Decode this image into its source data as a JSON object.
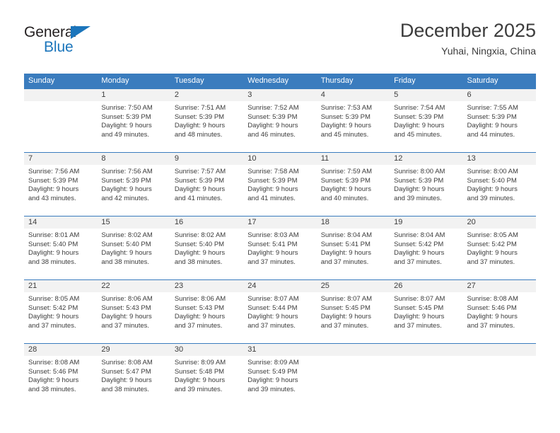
{
  "logo": {
    "word_top": "General",
    "word_bottom": "Blue",
    "triangle_color": "#1b75bb",
    "text_color": "#231f20"
  },
  "header": {
    "title": "December 2025",
    "subtitle": "Yuhai, Ningxia, China"
  },
  "theme": {
    "header_blue": "#3a7cbe",
    "daynum_band": "#f2f2f2",
    "text": "#3c3c3c"
  },
  "weekdays": [
    "Sunday",
    "Monday",
    "Tuesday",
    "Wednesday",
    "Thursday",
    "Friday",
    "Saturday"
  ],
  "weeks": [
    [
      {
        "day": "",
        "sunrise": "",
        "sunset": "",
        "daylight_1": "",
        "daylight_2": ""
      },
      {
        "day": "1",
        "sunrise": "Sunrise: 7:50 AM",
        "sunset": "Sunset: 5:39 PM",
        "daylight_1": "Daylight: 9 hours",
        "daylight_2": "and 49 minutes."
      },
      {
        "day": "2",
        "sunrise": "Sunrise: 7:51 AM",
        "sunset": "Sunset: 5:39 PM",
        "daylight_1": "Daylight: 9 hours",
        "daylight_2": "and 48 minutes."
      },
      {
        "day": "3",
        "sunrise": "Sunrise: 7:52 AM",
        "sunset": "Sunset: 5:39 PM",
        "daylight_1": "Daylight: 9 hours",
        "daylight_2": "and 46 minutes."
      },
      {
        "day": "4",
        "sunrise": "Sunrise: 7:53 AM",
        "sunset": "Sunset: 5:39 PM",
        "daylight_1": "Daylight: 9 hours",
        "daylight_2": "and 45 minutes."
      },
      {
        "day": "5",
        "sunrise": "Sunrise: 7:54 AM",
        "sunset": "Sunset: 5:39 PM",
        "daylight_1": "Daylight: 9 hours",
        "daylight_2": "and 45 minutes."
      },
      {
        "day": "6",
        "sunrise": "Sunrise: 7:55 AM",
        "sunset": "Sunset: 5:39 PM",
        "daylight_1": "Daylight: 9 hours",
        "daylight_2": "and 44 minutes."
      }
    ],
    [
      {
        "day": "7",
        "sunrise": "Sunrise: 7:56 AM",
        "sunset": "Sunset: 5:39 PM",
        "daylight_1": "Daylight: 9 hours",
        "daylight_2": "and 43 minutes."
      },
      {
        "day": "8",
        "sunrise": "Sunrise: 7:56 AM",
        "sunset": "Sunset: 5:39 PM",
        "daylight_1": "Daylight: 9 hours",
        "daylight_2": "and 42 minutes."
      },
      {
        "day": "9",
        "sunrise": "Sunrise: 7:57 AM",
        "sunset": "Sunset: 5:39 PM",
        "daylight_1": "Daylight: 9 hours",
        "daylight_2": "and 41 minutes."
      },
      {
        "day": "10",
        "sunrise": "Sunrise: 7:58 AM",
        "sunset": "Sunset: 5:39 PM",
        "daylight_1": "Daylight: 9 hours",
        "daylight_2": "and 41 minutes."
      },
      {
        "day": "11",
        "sunrise": "Sunrise: 7:59 AM",
        "sunset": "Sunset: 5:39 PM",
        "daylight_1": "Daylight: 9 hours",
        "daylight_2": "and 40 minutes."
      },
      {
        "day": "12",
        "sunrise": "Sunrise: 8:00 AM",
        "sunset": "Sunset: 5:39 PM",
        "daylight_1": "Daylight: 9 hours",
        "daylight_2": "and 39 minutes."
      },
      {
        "day": "13",
        "sunrise": "Sunrise: 8:00 AM",
        "sunset": "Sunset: 5:40 PM",
        "daylight_1": "Daylight: 9 hours",
        "daylight_2": "and 39 minutes."
      }
    ],
    [
      {
        "day": "14",
        "sunrise": "Sunrise: 8:01 AM",
        "sunset": "Sunset: 5:40 PM",
        "daylight_1": "Daylight: 9 hours",
        "daylight_2": "and 38 minutes."
      },
      {
        "day": "15",
        "sunrise": "Sunrise: 8:02 AM",
        "sunset": "Sunset: 5:40 PM",
        "daylight_1": "Daylight: 9 hours",
        "daylight_2": "and 38 minutes."
      },
      {
        "day": "16",
        "sunrise": "Sunrise: 8:02 AM",
        "sunset": "Sunset: 5:40 PM",
        "daylight_1": "Daylight: 9 hours",
        "daylight_2": "and 38 minutes."
      },
      {
        "day": "17",
        "sunrise": "Sunrise: 8:03 AM",
        "sunset": "Sunset: 5:41 PM",
        "daylight_1": "Daylight: 9 hours",
        "daylight_2": "and 37 minutes."
      },
      {
        "day": "18",
        "sunrise": "Sunrise: 8:04 AM",
        "sunset": "Sunset: 5:41 PM",
        "daylight_1": "Daylight: 9 hours",
        "daylight_2": "and 37 minutes."
      },
      {
        "day": "19",
        "sunrise": "Sunrise: 8:04 AM",
        "sunset": "Sunset: 5:42 PM",
        "daylight_1": "Daylight: 9 hours",
        "daylight_2": "and 37 minutes."
      },
      {
        "day": "20",
        "sunrise": "Sunrise: 8:05 AM",
        "sunset": "Sunset: 5:42 PM",
        "daylight_1": "Daylight: 9 hours",
        "daylight_2": "and 37 minutes."
      }
    ],
    [
      {
        "day": "21",
        "sunrise": "Sunrise: 8:05 AM",
        "sunset": "Sunset: 5:42 PM",
        "daylight_1": "Daylight: 9 hours",
        "daylight_2": "and 37 minutes."
      },
      {
        "day": "22",
        "sunrise": "Sunrise: 8:06 AM",
        "sunset": "Sunset: 5:43 PM",
        "daylight_1": "Daylight: 9 hours",
        "daylight_2": "and 37 minutes."
      },
      {
        "day": "23",
        "sunrise": "Sunrise: 8:06 AM",
        "sunset": "Sunset: 5:43 PM",
        "daylight_1": "Daylight: 9 hours",
        "daylight_2": "and 37 minutes."
      },
      {
        "day": "24",
        "sunrise": "Sunrise: 8:07 AM",
        "sunset": "Sunset: 5:44 PM",
        "daylight_1": "Daylight: 9 hours",
        "daylight_2": "and 37 minutes."
      },
      {
        "day": "25",
        "sunrise": "Sunrise: 8:07 AM",
        "sunset": "Sunset: 5:45 PM",
        "daylight_1": "Daylight: 9 hours",
        "daylight_2": "and 37 minutes."
      },
      {
        "day": "26",
        "sunrise": "Sunrise: 8:07 AM",
        "sunset": "Sunset: 5:45 PM",
        "daylight_1": "Daylight: 9 hours",
        "daylight_2": "and 37 minutes."
      },
      {
        "day": "27",
        "sunrise": "Sunrise: 8:08 AM",
        "sunset": "Sunset: 5:46 PM",
        "daylight_1": "Daylight: 9 hours",
        "daylight_2": "and 37 minutes."
      }
    ],
    [
      {
        "day": "28",
        "sunrise": "Sunrise: 8:08 AM",
        "sunset": "Sunset: 5:46 PM",
        "daylight_1": "Daylight: 9 hours",
        "daylight_2": "and 38 minutes."
      },
      {
        "day": "29",
        "sunrise": "Sunrise: 8:08 AM",
        "sunset": "Sunset: 5:47 PM",
        "daylight_1": "Daylight: 9 hours",
        "daylight_2": "and 38 minutes."
      },
      {
        "day": "30",
        "sunrise": "Sunrise: 8:09 AM",
        "sunset": "Sunset: 5:48 PM",
        "daylight_1": "Daylight: 9 hours",
        "daylight_2": "and 39 minutes."
      },
      {
        "day": "31",
        "sunrise": "Sunrise: 8:09 AM",
        "sunset": "Sunset: 5:49 PM",
        "daylight_1": "Daylight: 9 hours",
        "daylight_2": "and 39 minutes."
      },
      {
        "day": "",
        "sunrise": "",
        "sunset": "",
        "daylight_1": "",
        "daylight_2": ""
      },
      {
        "day": "",
        "sunrise": "",
        "sunset": "",
        "daylight_1": "",
        "daylight_2": ""
      },
      {
        "day": "",
        "sunrise": "",
        "sunset": "",
        "daylight_1": "",
        "daylight_2": ""
      }
    ]
  ]
}
